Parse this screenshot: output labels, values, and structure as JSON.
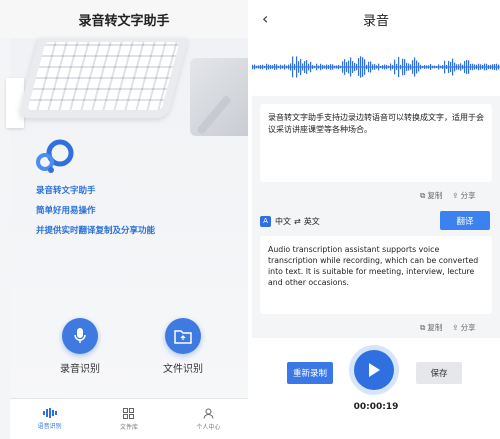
{
  "left": {
    "title": "录音转文字助手",
    "features": [
      "录音转文字助手",
      "简单好用易操作",
      "并提供实时翻译复制及分享功能"
    ],
    "buttons": {
      "record": "录音识别",
      "file": "文件识别"
    },
    "tabs": [
      "语音识别",
      "文件库",
      "个人中心"
    ]
  },
  "right": {
    "title": "录音",
    "source_text": "录音转文字助手支持边录边转语音可以转换成文字，适用于会议采访讲座课堂等各种场合。",
    "copy_label": "复制",
    "share_label": "分享",
    "lang_from": "中文",
    "lang_arrow": "⇄",
    "lang_to": "英文",
    "translate_label": "翻译",
    "translated_text": "Audio transcription assistant supports voice transcription while recording, which can be converted into text. It is suitable for meeting, interview, lecture and other occasions.",
    "rerecord_label": "重新录制",
    "save_label": "保存",
    "timer": "00:00:19"
  },
  "colors": {
    "accent": "#2f6fe0",
    "feature_text": "#2b6fd6"
  }
}
